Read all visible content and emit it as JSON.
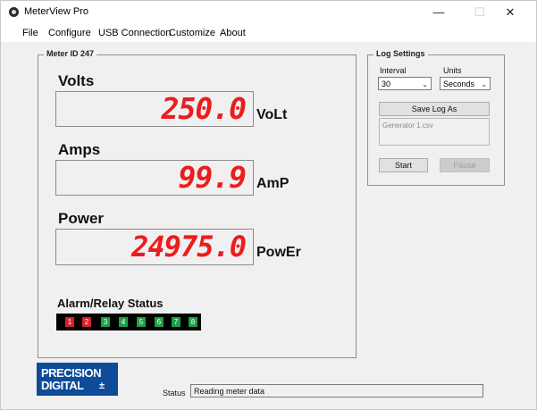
{
  "window": {
    "title": "MeterView Pro",
    "minimize": "—",
    "maximize": "☐",
    "close": "✕"
  },
  "menu": {
    "items": [
      "File",
      "Configure",
      "USB Connection",
      "Customize",
      "About"
    ]
  },
  "meter": {
    "group_title": "Meter ID 247",
    "channels": [
      {
        "label": "Volts",
        "value": "250.0",
        "unit": "VoLt"
      },
      {
        "label": "Amps",
        "value": "99.9",
        "unit": "AmP"
      },
      {
        "label": "Power",
        "value": "24975.0",
        "unit": "PowEr"
      }
    ],
    "digit_color": "#ee1c1c",
    "alarm_title": "Alarm/Relay Status",
    "relays": [
      {
        "label": "1",
        "state": "red"
      },
      {
        "label": "2",
        "state": "red"
      },
      {
        "label": "3",
        "state": "green"
      },
      {
        "label": "4",
        "state": "green"
      },
      {
        "label": "5",
        "state": "green"
      },
      {
        "label": "6",
        "state": "green"
      },
      {
        "label": "7",
        "state": "green"
      },
      {
        "label": "8",
        "state": "green"
      }
    ]
  },
  "log": {
    "group_title": "Log Settings",
    "interval_label": "Interval",
    "interval_value": "30",
    "units_label": "Units",
    "units_value": "Seconds",
    "save_button": "Save Log As",
    "file_name": "Generator 1.csv",
    "start_button": "Start",
    "pause_button": "Pause"
  },
  "logo": {
    "line1": "PRECISION",
    "line2": "DIGITAL"
  },
  "status": {
    "label": "Status",
    "value": "Reading meter data"
  },
  "colors": {
    "brand": "#0e4c9a",
    "relay_on": "#d8202a",
    "relay_off": "#1f9e46"
  }
}
